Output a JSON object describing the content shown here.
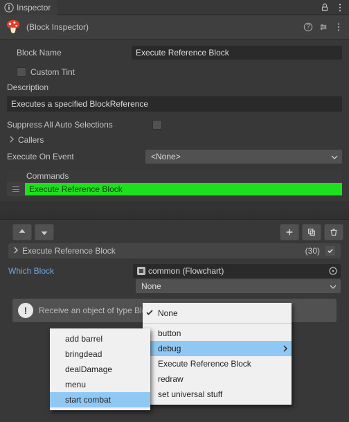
{
  "tab": {
    "label": "Inspector"
  },
  "header": {
    "subtitle": "(Block Inspector)"
  },
  "labels": {
    "blockName": "Block Name",
    "customTint": "Custom Tint",
    "description": "Description",
    "suppress": "Suppress All Auto Selections",
    "callers": "Callers",
    "executeOnEvent": "Execute On Event",
    "commands": "Commands",
    "whichBlock": "Which Block"
  },
  "fields": {
    "blockName": "Execute Reference Block",
    "descriptionValue": "Executes a specified BlockReference",
    "executeOnEvent": "<None>",
    "objectField": "common (Flowchart)",
    "noneDropdown": "None"
  },
  "command": {
    "label": "Execute Reference Block"
  },
  "collHead": {
    "title": "Execute Reference Block",
    "count": "(30)"
  },
  "info": {
    "text": "Receive an object of type Block"
  },
  "menuLeft": {
    "items": [
      "add barrel",
      "bringdead",
      "dealDamage",
      "menu",
      "start combat"
    ],
    "highlight": 4
  },
  "menuRight": {
    "items": [
      "None",
      "button",
      "debug",
      "Execute Reference Block",
      "redraw",
      "set universal stuff"
    ],
    "checked": 0,
    "highlight": 2,
    "submenu": 2
  }
}
